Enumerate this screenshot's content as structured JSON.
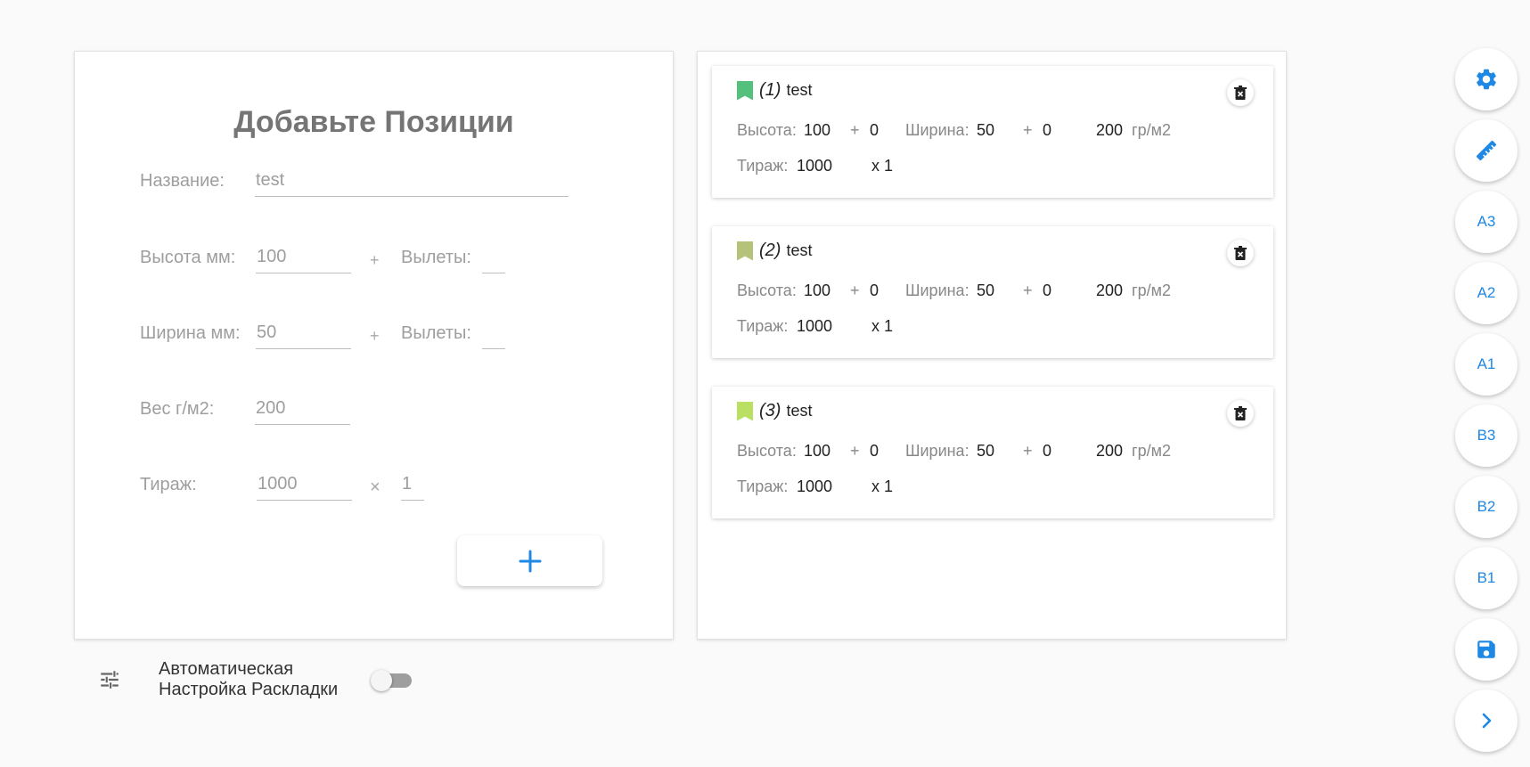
{
  "form": {
    "title": "Добавьте Позиции",
    "name_label": "Название:",
    "name_value": "test",
    "height_label": "Высота мм:",
    "height_value": "100",
    "height_bleed_label": "Вылеты:",
    "height_bleed_value": "",
    "width_label": "Ширина мм:",
    "width_value": "50",
    "width_bleed_label": "Вылеты:",
    "width_bleed_value": "",
    "weight_label": "Вес г/м2:",
    "weight_value": "200",
    "run_label": "Тираж:",
    "run_value": "1000",
    "multiplier_value": "1",
    "plus_sign": "+",
    "times_sign": "×",
    "add_button": "add-icon"
  },
  "items": [
    {
      "num": "(1)",
      "name": "test",
      "color": "#53c07b",
      "height_label": "Высота:",
      "height": "100",
      "height_bleed": "0",
      "width_label": "Ширина:",
      "width": "50",
      "width_bleed": "0",
      "weight": "200",
      "weight_unit": "гр/м2",
      "run_label": "Тираж:",
      "run": "1000",
      "mult": "x 1"
    },
    {
      "num": "(2)",
      "name": "test",
      "color": "#b5c27a",
      "height_label": "Высота:",
      "height": "100",
      "height_bleed": "0",
      "width_label": "Ширина:",
      "width": "50",
      "width_bleed": "0",
      "weight": "200",
      "weight_unit": "гр/м2",
      "run_label": "Тираж:",
      "run": "1000",
      "mult": "x 1"
    },
    {
      "num": "(3)",
      "name": "test",
      "color": "#b9e063",
      "height_label": "Высота:",
      "height": "100",
      "height_bleed": "0",
      "width_label": "Ширина:",
      "width": "50",
      "width_bleed": "0",
      "weight": "200",
      "weight_unit": "гр/м2",
      "run_label": "Тираж:",
      "run": "1000",
      "mult": "x 1"
    }
  ],
  "item_plus": "+",
  "toolbar": {
    "settings": "settings-icon",
    "measure": "ruler-icon",
    "a3": "A3",
    "a2": "A2",
    "a1": "A1",
    "b3": "B3",
    "b2": "B2",
    "b1": "B1",
    "save": "save-icon",
    "next": "chevron-right-icon"
  },
  "auto_layout": {
    "label_line1": "Автоматическая",
    "label_line2": "Настройка Раскладки",
    "enabled": false
  },
  "colors": {
    "accent": "#1e88e5"
  }
}
